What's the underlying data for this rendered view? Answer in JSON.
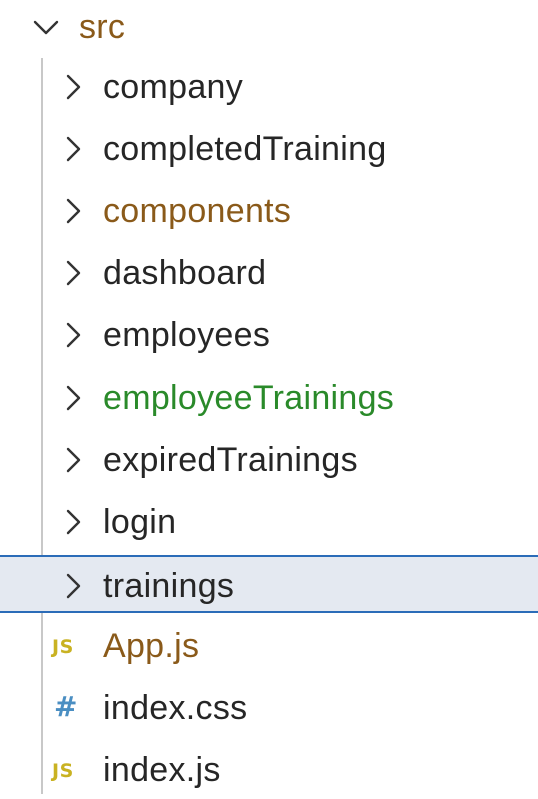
{
  "explorer": {
    "root": {
      "label": "src",
      "color": "#8a5a1a",
      "icon": "chevron-down-icon",
      "expanded": true
    },
    "items": [
      {
        "label": "company",
        "type": "folder",
        "color": "#262626",
        "icon": "chevron-right-icon"
      },
      {
        "label": "completedTraining",
        "type": "folder",
        "color": "#262626",
        "icon": "chevron-right-icon"
      },
      {
        "label": "components",
        "type": "folder",
        "color": "#8a5a1a",
        "icon": "chevron-right-icon"
      },
      {
        "label": "dashboard",
        "type": "folder",
        "color": "#262626",
        "icon": "chevron-right-icon"
      },
      {
        "label": "employees",
        "type": "folder",
        "color": "#262626",
        "icon": "chevron-right-icon"
      },
      {
        "label": "employeeTrainings",
        "type": "folder",
        "color": "#2a8a2a",
        "icon": "chevron-right-icon"
      },
      {
        "label": "expiredTrainings",
        "type": "folder",
        "color": "#262626",
        "icon": "chevron-right-icon"
      },
      {
        "label": "login",
        "type": "folder",
        "color": "#262626",
        "icon": "chevron-right-icon"
      },
      {
        "label": "trainings",
        "type": "folder",
        "color": "#262626",
        "icon": "chevron-right-icon",
        "selected": true
      },
      {
        "label": "App.js",
        "type": "file",
        "color": "#8a5a1a",
        "icon": "js-file-icon",
        "icon_text": "JS",
        "icon_color": "#c9b222"
      },
      {
        "label": "index.css",
        "type": "file",
        "color": "#262626",
        "icon": "css-file-icon",
        "icon_text": "#",
        "icon_color": "#4a8ec2"
      },
      {
        "label": "index.js",
        "type": "file",
        "color": "#262626",
        "icon": "js-file-icon",
        "icon_text": "JS",
        "icon_color": "#c9b222"
      }
    ]
  }
}
